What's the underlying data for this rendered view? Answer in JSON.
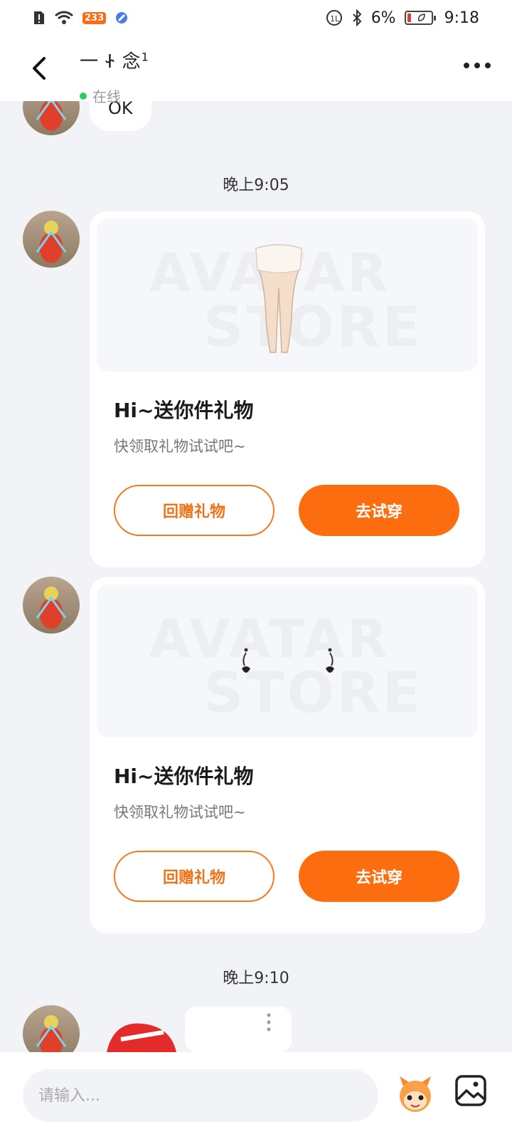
{
  "status_bar": {
    "badge": "233",
    "battery_percent": "6%",
    "time": "9:18"
  },
  "header": {
    "back_icon": "chevron-left-icon",
    "contact_name": "一 Ꮠ 念",
    "contact_name_suffix": "1",
    "online_status": "在线",
    "more_icon": "more-horizontal-icon"
  },
  "messages": {
    "prev_bubble_text": "OK",
    "timestamp_1": "晚上9:05",
    "gift_1": {
      "watermark_line1": "AVATAR",
      "watermark_line2": "STORE",
      "title": "Hi~送你件礼物",
      "subtitle": "快领取礼物试试吧~",
      "return_gift_label": "回赠礼物",
      "try_on_label": "去试穿"
    },
    "gift_2": {
      "watermark_line1": "AVATAR",
      "watermark_line2": "STORE",
      "title": "Hi~送你件礼物",
      "subtitle": "快领取礼物试试吧~",
      "return_gift_label": "回赠礼物",
      "try_on_label": "去试穿"
    },
    "timestamp_2": "晚上9:10"
  },
  "input_bar": {
    "placeholder": "请输入...",
    "value": "",
    "emoji_icon": "mascot-emoji-icon",
    "image_icon": "image-picker-icon"
  },
  "colors": {
    "accent": "#fb6d0f",
    "background": "#f2f3f7",
    "online": "#33c96b"
  }
}
